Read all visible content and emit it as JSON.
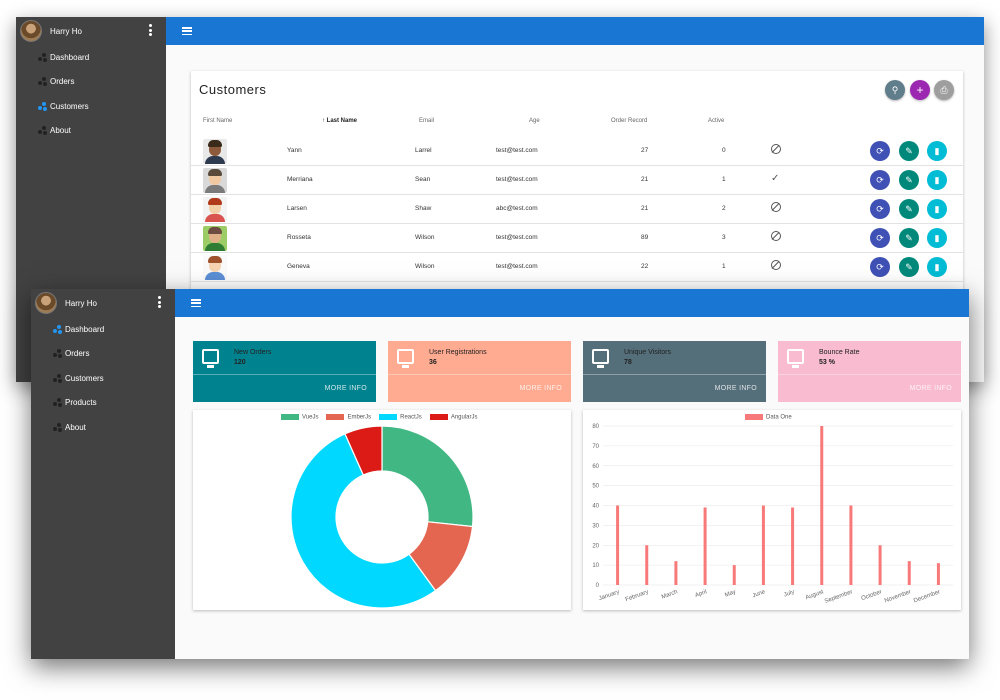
{
  "back_window": {
    "user": {
      "name": "Harry Ho"
    },
    "nav": [
      {
        "label": "Dashboard",
        "active": false
      },
      {
        "label": "Orders",
        "active": false
      },
      {
        "label": "Customers",
        "active": true
      },
      {
        "label": "About",
        "active": false
      }
    ],
    "customers": {
      "title": "Customers",
      "columns": [
        "First Name",
        "Last Name",
        "Email",
        "Age",
        "Order Record",
        "Active"
      ],
      "sorted_column_label": "↑ Last Name",
      "rows": [
        {
          "first": "Yann",
          "last": "Larrel",
          "email": "test@test.com",
          "age": "27",
          "orders": "0",
          "active": false,
          "avatar": "avatar-man-dark"
        },
        {
          "first": "Merriana",
          "last": "Sean",
          "email": "test@test.com",
          "age": "21",
          "orders": "1",
          "active": true,
          "avatar": "avatar-man-grey"
        },
        {
          "first": "Larsen",
          "last": "Shaw",
          "email": "abc@test.com",
          "age": "21",
          "orders": "2",
          "active": false,
          "avatar": "avatar-woman-red"
        },
        {
          "first": "Rosseta",
          "last": "Wilson",
          "email": "test@test.com",
          "age": "89",
          "orders": "3",
          "active": false,
          "avatar": "avatar-man-green"
        },
        {
          "first": "Geneva",
          "last": "Wilson",
          "email": "test@test.com",
          "age": "22",
          "orders": "1",
          "active": false,
          "avatar": "avatar-woman-white"
        }
      ],
      "actions": [
        "search-icon",
        "add-icon",
        "print-icon"
      ],
      "row_actions": [
        "refresh-icon",
        "edit-icon",
        "delete-icon"
      ]
    }
  },
  "front_window": {
    "user": {
      "name": "Harry Ho"
    },
    "nav": [
      {
        "label": "Dashboard",
        "active": true
      },
      {
        "label": "Orders",
        "active": false
      },
      {
        "label": "Customers",
        "active": false
      },
      {
        "label": "Products",
        "active": false
      },
      {
        "label": "About",
        "active": false
      }
    ],
    "stats": [
      {
        "label": "New Orders",
        "value": "120",
        "more": "MORE INFO",
        "color": "#00838f",
        "icon": "monitor-icon"
      },
      {
        "label": "User Registrations",
        "value": "36",
        "more": "MORE INFO",
        "color": "#ffab91",
        "icon": "monitor-icon"
      },
      {
        "label": "Unique Visitors",
        "value": "78",
        "more": "MORE INFO",
        "color": "#546e7a",
        "icon": "monitor-icon"
      },
      {
        "label": "Bounce Rate",
        "value": "53 %",
        "more": "MORE INFO",
        "color": "#f8bbd0",
        "icon": "monitor-icon"
      }
    ]
  },
  "chart_data": [
    {
      "type": "pie",
      "subtype": "doughnut",
      "categories": [
        "VueJs",
        "EmberJs",
        "ReactJs",
        "AngularJs"
      ],
      "values": [
        40,
        20,
        80,
        10
      ],
      "colors": [
        "#41b883",
        "#e46651",
        "#00d8ff",
        "#dd1b16"
      ],
      "legend": "top"
    },
    {
      "type": "bar",
      "categories": [
        "January",
        "February",
        "March",
        "April",
        "May",
        "June",
        "July",
        "August",
        "September",
        "October",
        "November",
        "December"
      ],
      "series": [
        {
          "name": "Data One",
          "values": [
            40,
            20,
            12,
            39,
            10,
            40,
            39,
            80,
            40,
            20,
            12,
            11
          ],
          "color": "#f87979"
        }
      ],
      "ylim": [
        0,
        80
      ],
      "yticks": [
        0,
        10,
        20,
        30,
        40,
        50,
        60,
        70,
        80
      ],
      "grid": "horizontal",
      "legend": "top"
    }
  ]
}
